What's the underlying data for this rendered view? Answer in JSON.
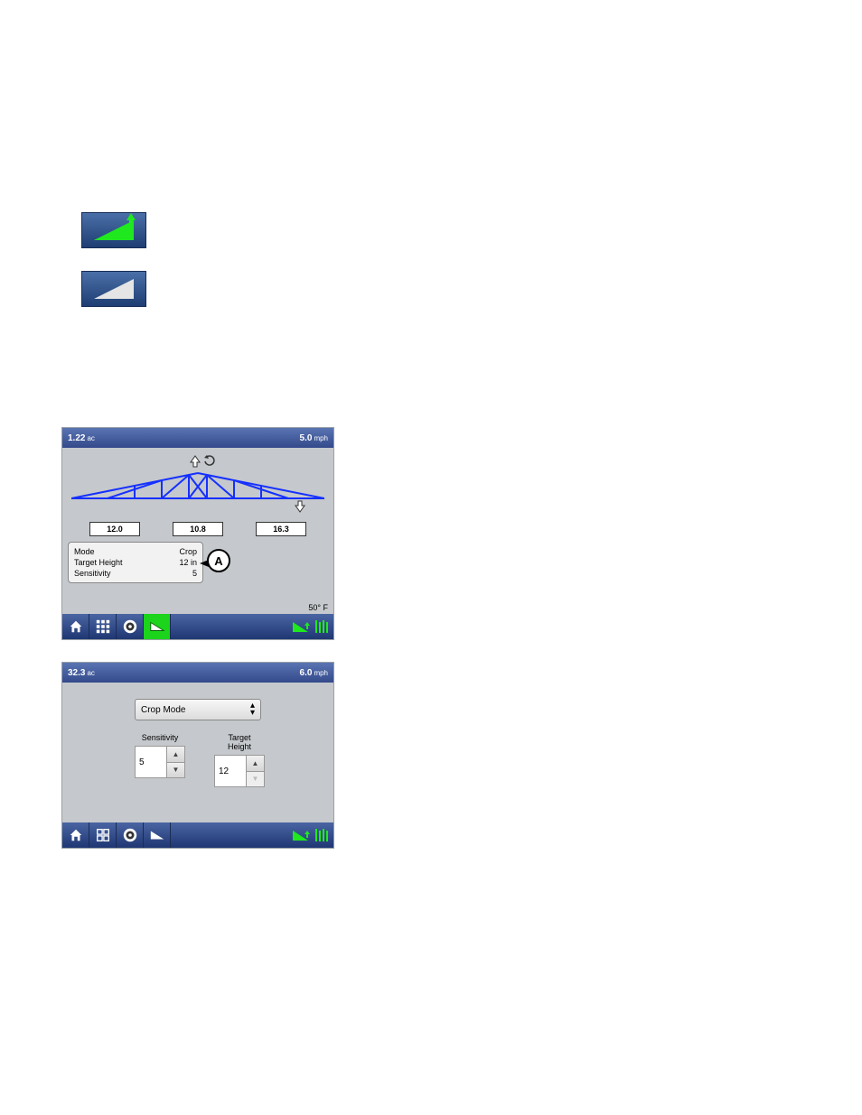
{
  "standalone_icons": {
    "green_wedge_up": "boom-raise-active-icon",
    "white_wedge": "boom-raise-inactive-icon"
  },
  "screen1": {
    "topbar": {
      "area_value": "1.22",
      "area_unit": "ac",
      "speed_value": "5.0",
      "speed_unit": "mph"
    },
    "readouts": {
      "left": "12.0",
      "center": "10.8",
      "right": "16.3"
    },
    "info_panel": {
      "mode_label": "Mode",
      "mode_value": "Crop",
      "target_height_label": "Target Height",
      "target_height_value": "12 in",
      "sensitivity_label": "Sensitivity",
      "sensitivity_value": "5"
    },
    "callout": "A",
    "temp": {
      "value": "50",
      "unit": "° F"
    },
    "nav": {
      "home": "home-icon",
      "grid": "grid-9-icon",
      "target": "target-icon",
      "wedge_active": true,
      "right1": "boom-raise-icon",
      "right2": "crop-icon"
    }
  },
  "screen2": {
    "topbar": {
      "area_value": "32.3",
      "area_unit": "ac",
      "speed_value": "6.0",
      "speed_unit": "mph"
    },
    "dropdown": {
      "selected": "Crop Mode"
    },
    "sensitivity": {
      "label": "Sensitivity",
      "value": "5"
    },
    "target_height": {
      "label": "Target\nHeight",
      "value": "12"
    },
    "nav": {
      "home": "home-icon",
      "grid": "grid-4-icon",
      "target": "target-icon",
      "wedge_active": false,
      "right1": "boom-raise-icon",
      "right2": "crop-icon"
    }
  }
}
